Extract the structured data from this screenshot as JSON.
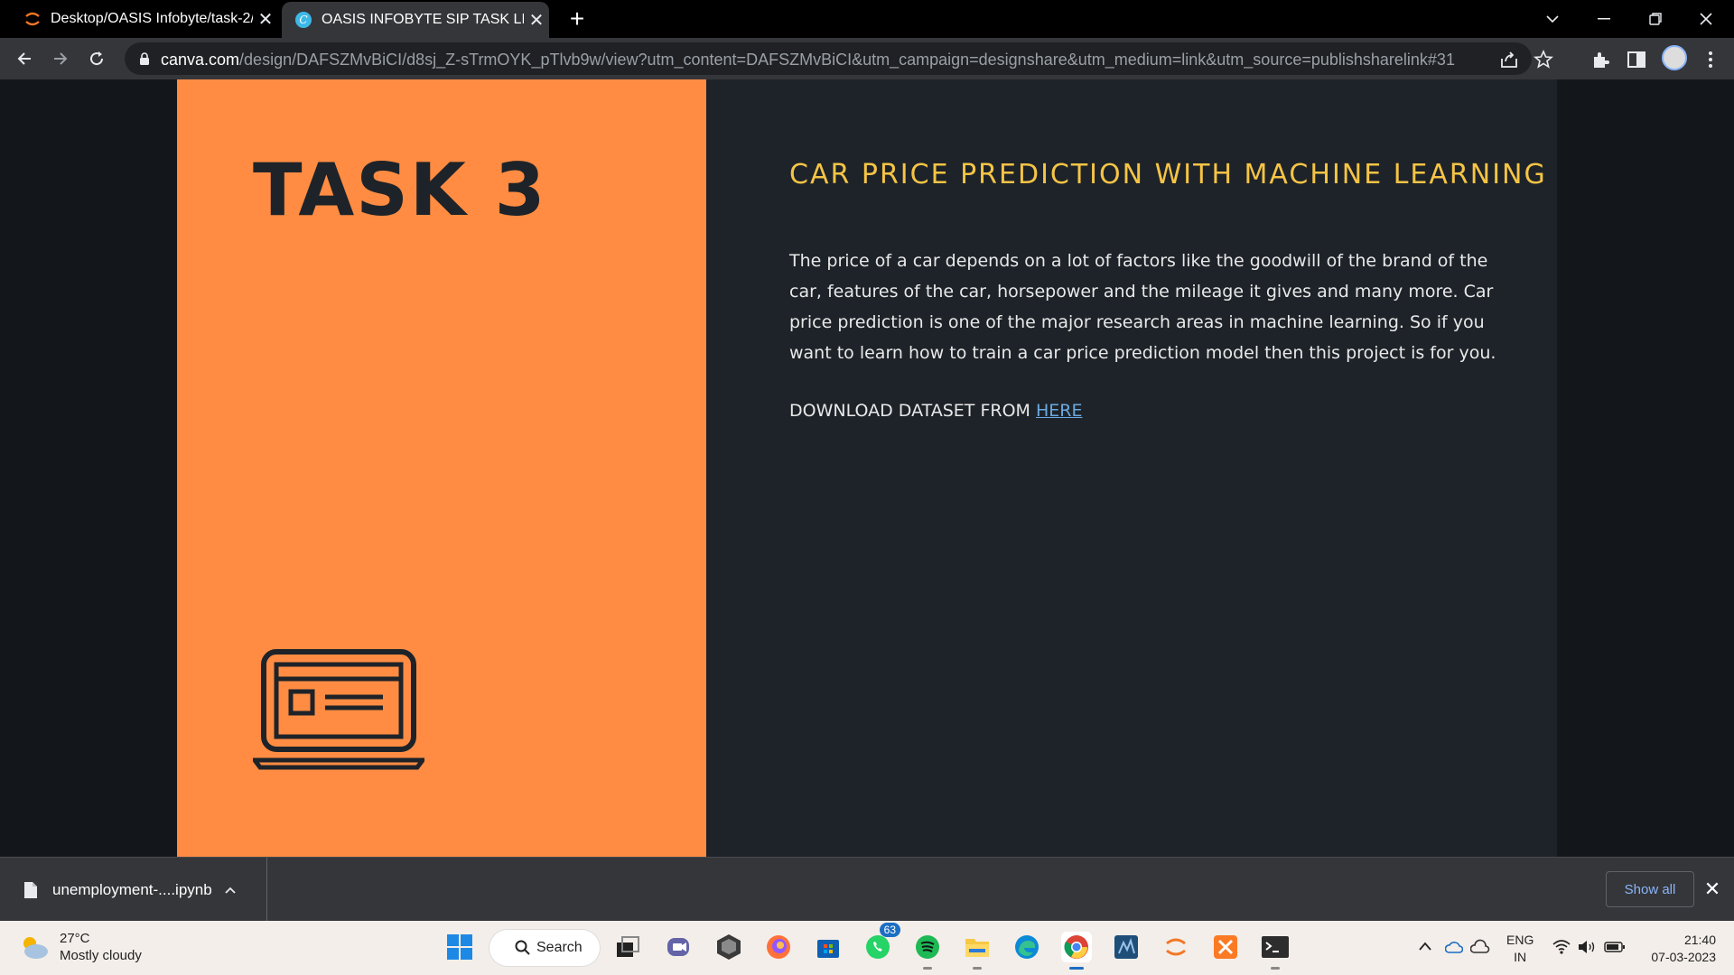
{
  "browser": {
    "tabs": [
      {
        "title": "Desktop/OASIS Infobyte/task-2/",
        "active": false
      },
      {
        "title": "OASIS INFOBYTE SIP TASK LIST",
        "active": true
      }
    ],
    "url_host": "canva.com",
    "url_path": "/design/DAFSZMvBiCI/d8sj_Z-sTrmOYK_pTlvb9w/view?utm_content=DAFSZMvBiCI&utm_campaign=designshare&utm_medium=link&utm_source=publishsharelink#31"
  },
  "slide": {
    "task_title": "TASK 3",
    "heading": "CAR PRICE PREDICTION WITH MACHINE LEARNING",
    "description": "The price of a car depends on a lot of factors like the goodwill of the brand of the car, features of the car, horsepower and the mileage it gives and many more. Car price prediction is one of the major research areas in machine learning. So if you want to learn how to train a car price prediction model then this project is for you.",
    "download_prefix": "DOWNLOAD DATASET FROM ",
    "download_link": "HERE",
    "colors": {
      "left_panel": "#ff8c42",
      "right_panel": "#1e2329",
      "heading": "#f6c445",
      "link": "#6aa9e0"
    }
  },
  "download_bar": {
    "file_name": "unemployment-....ipynb",
    "show_all": "Show all"
  },
  "taskbar": {
    "weather_temp": "27°C",
    "weather_desc": "Mostly cloudy",
    "search_label": "Search",
    "whatsapp_badge": "63",
    "lang_line1": "ENG",
    "lang_line2": "IN",
    "time": "21:40",
    "date": "07-03-2023",
    "apps": [
      "start-icon",
      "task-view-icon",
      "teams-chat-icon",
      "obs-icon",
      "firefox-icon",
      "store-icon",
      "whatsapp-icon",
      "spotify-icon",
      "file-explorer-icon",
      "edge-icon",
      "chrome-icon",
      "mysql-workbench-icon",
      "jupyter-icon",
      "xampp-icon",
      "terminal-icon"
    ]
  }
}
